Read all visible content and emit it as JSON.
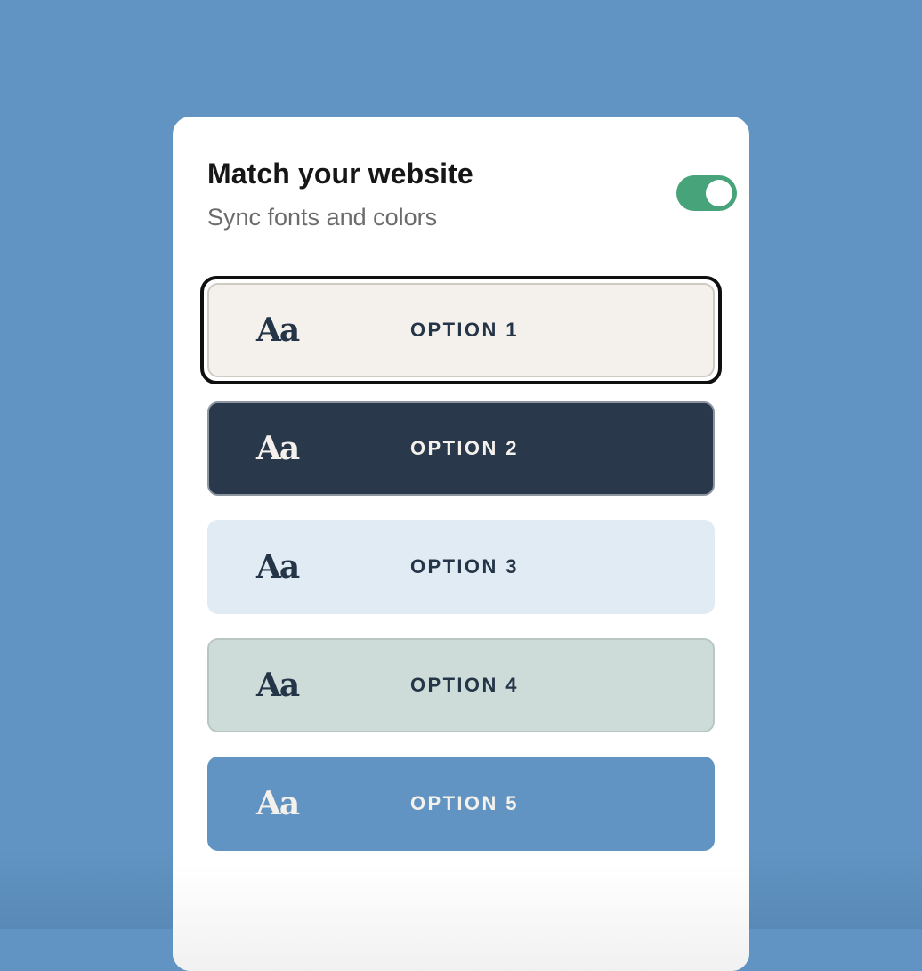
{
  "panel": {
    "title": "Match your website",
    "subtitle": "Sync fonts and colors",
    "toggle": {
      "on": true,
      "color": "#46a37a"
    }
  },
  "options": [
    {
      "label": "OPTION 1",
      "sample": "Aa",
      "bg": "#f4f1ec",
      "fg": "#253548",
      "border": "#cfcac2",
      "selected": true
    },
    {
      "label": "OPTION 2",
      "sample": "Aa",
      "bg": "#29384a",
      "fg": "#f4f1ec",
      "border": "#8d95a0",
      "selected": false
    },
    {
      "label": "OPTION 3",
      "sample": "Aa",
      "bg": "#e1ebf4",
      "fg": "#253548",
      "border": "#e1ebf4",
      "selected": false
    },
    {
      "label": "OPTION 4",
      "sample": "Aa",
      "bg": "#cedcd9",
      "fg": "#253548",
      "border": "#b8c7c3",
      "selected": false
    },
    {
      "label": "OPTION 5",
      "sample": "Aa",
      "bg": "#6194c2",
      "fg": "#f4f1ec",
      "border": "#6194c2",
      "selected": false
    }
  ],
  "colors": {
    "background": "#6194c2",
    "card": "#ffffff"
  }
}
